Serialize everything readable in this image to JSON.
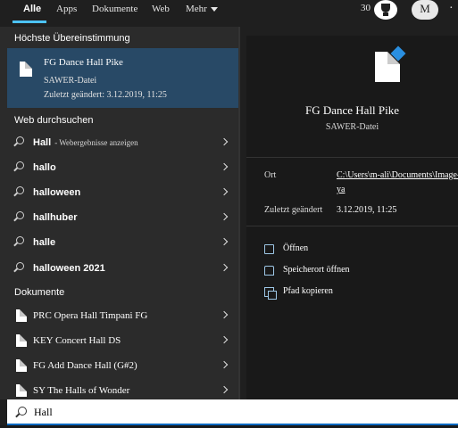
{
  "tabs": [
    {
      "label": "Alle",
      "active": true
    },
    {
      "label": "Apps"
    },
    {
      "label": "Dokumente"
    },
    {
      "label": "Web"
    },
    {
      "label": "Mehr"
    }
  ],
  "header": {
    "points": "30",
    "rewards_icon": "trophy-icon",
    "avatar_letter": "M",
    "more_icon": "ellipsis-icon"
  },
  "best_match": {
    "heading": "Höchste Übereinstimmung",
    "title": "FG Dance Hall Pike",
    "type": "SAWER-Datei",
    "modified": "Zuletzt geändert: 3.12.2019, 11:25"
  },
  "web": {
    "heading": "Web durchsuchen",
    "items": [
      {
        "label": "Hall",
        "hint": "- Webergebnisse anzeigen"
      },
      {
        "label": "hallo"
      },
      {
        "label": "halloween"
      },
      {
        "label": "hallhuber"
      },
      {
        "label": "halle"
      },
      {
        "label": "halloween 2021"
      }
    ]
  },
  "documents": {
    "heading": "Dokumente",
    "items": [
      {
        "label": "PRC Opera Hall Timpani FG"
      },
      {
        "label": "KEY Concert Hall DS"
      },
      {
        "label": "FG Add Dance Hall (G#2)"
      },
      {
        "label": "SY The Halls of Wonder"
      }
    ]
  },
  "preview": {
    "title": "FG Dance Hall Pike",
    "type": "SAWER-Datei",
    "location_label": "Ort",
    "location_value_line1": "C:\\Users\\m-ali\\Documents\\Image-",
    "location_value_line2": "ya",
    "modified_label": "Zuletzt geändert",
    "modified_value": "3.12.2019, 11:25",
    "actions": [
      {
        "label": "Öffnen",
        "icon": "open-icon"
      },
      {
        "label": "Speicherort öffnen",
        "icon": "folder-icon"
      },
      {
        "label": "Pfad kopieren",
        "icon": "copy-icon"
      }
    ]
  },
  "search": {
    "value": "Hall"
  },
  "colors": {
    "accent": "#4cc2ff",
    "selection": "#284966",
    "panel": "#2b2b2b",
    "preview_bg": "#191919"
  }
}
